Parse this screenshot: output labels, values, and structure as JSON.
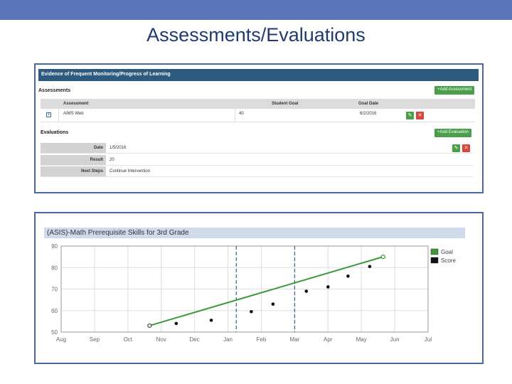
{
  "slide": {
    "title": "Assessments/Evaluations",
    "bar_color": "#5a76b8"
  },
  "panel": {
    "header": "Evidence of Frequent Monitoring/Progress of Learning",
    "assessments_label": "Assessments",
    "add_assessment_label": "+Add Assessment",
    "table": {
      "columns": [
        "Assessment",
        "Student Goal",
        "Goal Date"
      ],
      "rows": [
        {
          "assessment": "AIMS Web",
          "student_goal": "40",
          "goal_date": "6/2/2016"
        }
      ]
    },
    "evaluations_label": "Evaluations",
    "add_evaluation_label": "+Add Evaluation",
    "evaluation": [
      {
        "label": "Date",
        "value": "1/5/2016"
      },
      {
        "label": "Result",
        "value": "20"
      },
      {
        "label": "Next Steps",
        "value": "Continue Intervention"
      }
    ]
  },
  "chart_panel": {
    "title": "(ASIS)-Math Prerequisite Skills for 3rd Grade"
  },
  "chart_data": {
    "type": "line",
    "title": "(ASIS)-Math Prerequisite Skills for 3rd Grade",
    "x_ticks": [
      "Aug",
      "Sep",
      "Oct",
      "Nov",
      "Dec",
      "Jan",
      "Feb",
      "Mar",
      "Apr",
      "May",
      "Jun",
      "Jul"
    ],
    "ylim": [
      50,
      90
    ],
    "y_ticks": [
      50,
      60,
      70,
      80,
      90
    ],
    "grid": true,
    "legend_position": "right",
    "vertical_markers": [
      5.25,
      7.0
    ],
    "series": [
      {
        "name": "Goal",
        "color": "#3a9a3a",
        "style": "line",
        "points": [
          [
            2.65,
            53
          ],
          [
            9.65,
            85
          ]
        ]
      },
      {
        "name": "Score",
        "color": "#111111",
        "style": "scatter",
        "points": [
          [
            3.45,
            54
          ],
          [
            4.5,
            55.5
          ],
          [
            5.7,
            59.5
          ],
          [
            6.35,
            63
          ],
          [
            7.35,
            69
          ],
          [
            8.0,
            71
          ],
          [
            8.6,
            76
          ],
          [
            9.25,
            80.5
          ]
        ]
      }
    ]
  }
}
